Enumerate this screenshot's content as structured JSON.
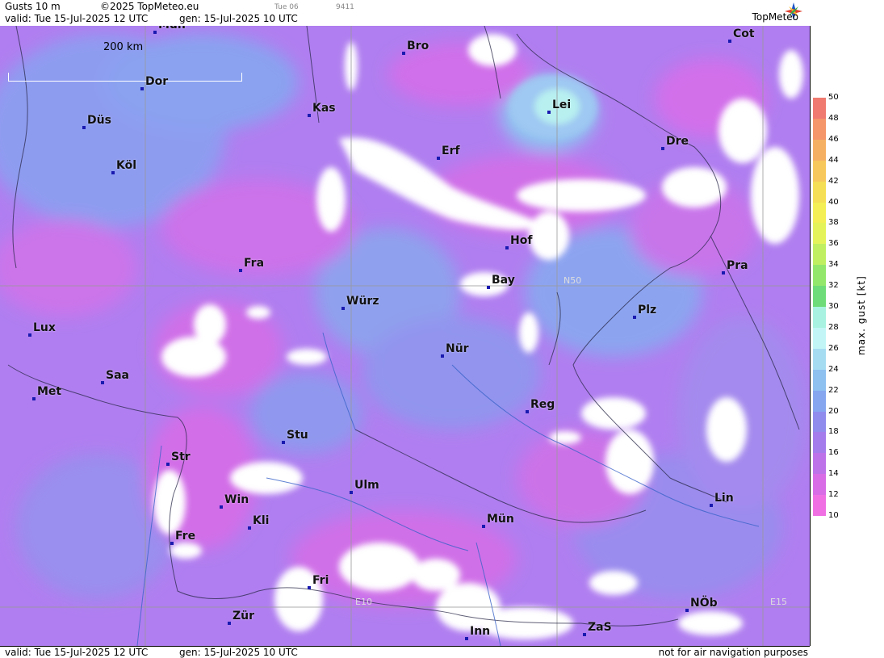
{
  "header": {
    "product": "Gusts 10 m",
    "copyright": "©2025 TopMeteo.eu",
    "run_day": "Tue 06",
    "code": "9411",
    "valid": "valid:  Tue  15-Jul-2025  12 UTC",
    "gen": "gen: 15-Jul-2025 10 UTC",
    "logo": "TopMeteo"
  },
  "footer": {
    "valid": "valid:  Tue  15-Jul-2025  12 UTC",
    "gen": "gen: 15-Jul-2025 10 UTC",
    "disclaimer": "not for air navigation purposes"
  },
  "scale_bar": "200 km",
  "grid_labels": {
    "lat": "N50",
    "lon1": "E10",
    "lon2": "E15"
  },
  "legend": {
    "title": "max. gust [kt]",
    "ticks": [
      "50",
      "48",
      "46",
      "44",
      "42",
      "40",
      "38",
      "36",
      "34",
      "32",
      "30",
      "28",
      "26",
      "24",
      "22",
      "20",
      "18",
      "16",
      "14",
      "12",
      "10"
    ],
    "colors": [
      "#f07a70",
      "#f4956a",
      "#f6b064",
      "#f7c85c",
      "#f5df55",
      "#f3ef55",
      "#e4f35a",
      "#c0ef62",
      "#93e86c",
      "#6edc78",
      "#a7f2e0",
      "#c2f6f6",
      "#a6dcf2",
      "#8ec0f0",
      "#86a6f0",
      "#8f8cee",
      "#a47cec",
      "#bd72ea",
      "#d86ce6",
      "#f070e4"
    ]
  },
  "cities": [
    {
      "name": "Mün"
    },
    {
      "name": "Bro"
    },
    {
      "name": "Cot"
    },
    {
      "name": "Dor"
    },
    {
      "name": "Kas"
    },
    {
      "name": "Lei"
    },
    {
      "name": "Düs"
    },
    {
      "name": "Erf"
    },
    {
      "name": "Dre"
    },
    {
      "name": "Köl"
    },
    {
      "name": "Hof"
    },
    {
      "name": "Fra"
    },
    {
      "name": "Bay"
    },
    {
      "name": "Pra"
    },
    {
      "name": "Würz"
    },
    {
      "name": "Plz"
    },
    {
      "name": "Lux"
    },
    {
      "name": "Nür"
    },
    {
      "name": "Saa"
    },
    {
      "name": "Met"
    },
    {
      "name": "Reg"
    },
    {
      "name": "Stu"
    },
    {
      "name": "Str"
    },
    {
      "name": "Ulm"
    },
    {
      "name": "Lin"
    },
    {
      "name": "Win"
    },
    {
      "name": "Kli"
    },
    {
      "name": "Mün"
    },
    {
      "name": "Fre"
    },
    {
      "name": "Fri"
    },
    {
      "name": "NÖb"
    },
    {
      "name": "Zür"
    },
    {
      "name": "ZaS"
    },
    {
      "name": "Inn"
    }
  ]
}
